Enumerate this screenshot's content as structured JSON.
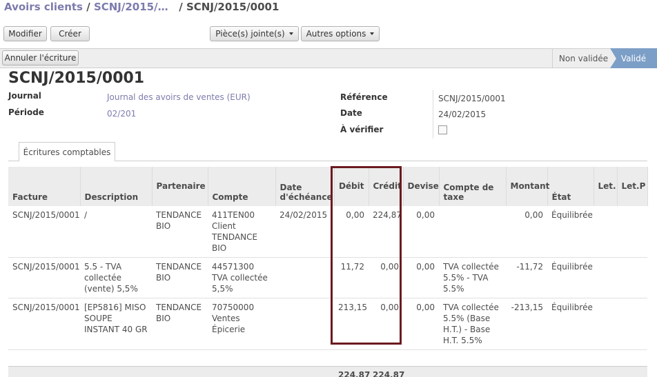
{
  "breadcrumb": {
    "parent": "Avoirs clients",
    "sep1": "/",
    "middle": "SCNJ/2015/…",
    "sep2": "/",
    "current": "SCNJ/2015/0001"
  },
  "toolbar": {
    "edit_label": "Modifier",
    "create_label": "Créer",
    "attachments_label": "Pièce(s) jointe(s)",
    "more_label": "Autres options",
    "cancel_entry_label": "Annuler l'écriture"
  },
  "statusbar": {
    "draft": "Non validée",
    "posted": "Validé"
  },
  "record": {
    "title": "SCNJ/2015/0001",
    "journal_label": "Journal",
    "journal_value": "Journal des avoirs de ventes (EUR)",
    "period_label": "Période",
    "period_value": "02/201",
    "reference_label": "Référence",
    "reference_value": "SCNJ/2015/0001",
    "date_label": "Date",
    "date_value": "24/02/2015",
    "to_check_label": "À vérifier"
  },
  "tab": {
    "label": "Écritures comptables"
  },
  "table": {
    "headers": {
      "invoice": "Facture",
      "description": "Description",
      "partner": "Partenaire",
      "account": "Compte",
      "due_date": "Date d'échéance",
      "debit": "Débit",
      "credit": "Crédit",
      "currency": "Devise",
      "tax_account": "Compte de taxe",
      "amount": "Montant",
      "state": "État",
      "reconcile": "Let.",
      "partial_reconcile": "Let.P"
    },
    "rows": [
      {
        "invoice": "SCNJ/2015/0001",
        "description": "/",
        "partner": "TENDANCE BIO",
        "account": "411TEN00 Client TENDANCE BIO",
        "due_date": "24/02/2015",
        "debit": "0,00",
        "credit": "224,87",
        "currency": "0,00",
        "tax_account": "",
        "amount": "0,00",
        "state": "Équilibrée"
      },
      {
        "invoice": "SCNJ/2015/0001",
        "description": "5.5 - TVA collectée (vente) 5,5%",
        "partner": "TENDANCE BIO",
        "account": "44571300 TVA collectée 5,5%",
        "due_date": "",
        "debit": "11,72",
        "credit": "0,00",
        "currency": "0,00",
        "tax_account": "TVA collectée 5.5% - TVA 5.5%",
        "amount": "-11,72",
        "state": "Équilibrée"
      },
      {
        "invoice": "SCNJ/2015/0001",
        "description": "[EP5816] MISO SOUPE INSTANT 40 GR",
        "partner": "TENDANCE BIO",
        "account": "70750000 Ventes Épicerie",
        "due_date": "",
        "debit": "213,15",
        "credit": "0,00",
        "currency": "0,00",
        "tax_account": "TVA collectée 5.5% (Base H.T.) - Base H.T. 5.5%",
        "amount": "-213,15",
        "state": "Équilibrée"
      }
    ],
    "totals": {
      "debit": "224,87",
      "credit": "224,87"
    }
  },
  "colors": {
    "link": "#7c7bad",
    "status_active": "#7c9fc7",
    "highlight_border": "#6b1a1f"
  }
}
